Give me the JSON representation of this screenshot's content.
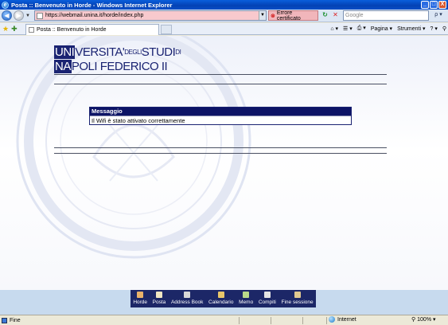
{
  "window": {
    "title": "Posta :: Benvenuto in Horde - Windows Internet Explorer",
    "minimize": "_",
    "maximize": "□",
    "close": "X"
  },
  "addressbar": {
    "url": "https://webmail.unina.it/horde/index.php",
    "cert_error": "Errore certificato",
    "search_placeholder": "Google",
    "search_button": "ρ ▾"
  },
  "tabs": [
    {
      "label": "Posta :: Benvenuto in Horde"
    }
  ],
  "commandbar": {
    "home": "⌂ ▾",
    "feeds": "☰ ▾",
    "print": "⎙ ▾",
    "page": "Pagina ▾",
    "tools": "Strumenti ▾",
    "help": "? ▾",
    "research": "⚲"
  },
  "logo": {
    "line1_block": "UNI",
    "line1_text": "VERSITA'",
    "line1_small": "DEGLI",
    "line1_text2": "STUDI",
    "line1_small2": "DI",
    "line2_block": "NA",
    "line2_text": "POLI FEDERICO II"
  },
  "message": {
    "heading": "Messaggio",
    "body": "Il Wifi è stato attivato correttamente"
  },
  "menu": [
    {
      "label": "Horde",
      "icon": "house-icon",
      "color": "#e9b26a"
    },
    {
      "label": "Posta",
      "icon": "mail-icon",
      "color": "#f0e6c2"
    },
    {
      "label": "Address Book",
      "icon": "address-book-icon",
      "color": "#d8d8d8"
    },
    {
      "label": "Calendario",
      "icon": "calendar-icon",
      "color": "#e8c66a"
    },
    {
      "label": "Memo",
      "icon": "memo-icon",
      "color": "#b9d98a"
    },
    {
      "label": "Compiti",
      "icon": "tasks-icon",
      "color": "#e4e4e4"
    },
    {
      "label": "Fine sessione",
      "icon": "logout-icon",
      "color": "#e0c890"
    }
  ],
  "statusbar": {
    "status": "Fine",
    "zone": "Internet",
    "zoom": "100%"
  }
}
